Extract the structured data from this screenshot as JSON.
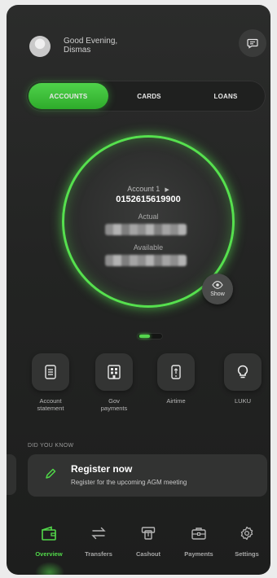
{
  "header": {
    "greeting": "Good Evening,",
    "name": "Dismas"
  },
  "tabs": [
    {
      "label": "ACCOUNTS",
      "active": true
    },
    {
      "label": "CARDS",
      "active": false
    },
    {
      "label": "LOANS",
      "active": false
    }
  ],
  "account": {
    "label": "Account 1",
    "number": "0152615619900",
    "actual_label": "Actual",
    "available_label": "Available",
    "show_label": "Show"
  },
  "quick_actions": [
    {
      "label": "Account\nstatement",
      "icon": "document-icon"
    },
    {
      "label": "Gov\npayments",
      "icon": "building-icon"
    },
    {
      "label": "Airtime",
      "icon": "phone-icon"
    },
    {
      "label": "LUKU",
      "icon": "lightbulb-icon"
    }
  ],
  "did_you_know": {
    "heading": "DID YOU KNOW",
    "title": "Register now",
    "text": "Register for the upcoming AGM meeting"
  },
  "nav": [
    {
      "label": "Overview",
      "icon": "wallet-icon",
      "active": true
    },
    {
      "label": "Transfers",
      "icon": "transfer-icon",
      "active": false
    },
    {
      "label": "Cashout",
      "icon": "cashout-icon",
      "active": false
    },
    {
      "label": "Payments",
      "icon": "briefcase-icon",
      "active": false
    },
    {
      "label": "Settings",
      "icon": "gear-icon",
      "active": false
    }
  ],
  "colors": {
    "accent": "#52d84a",
    "background": "#242524"
  }
}
